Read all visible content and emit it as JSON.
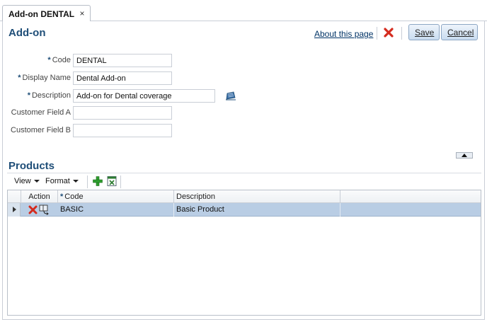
{
  "tab": {
    "label": "Add-on DENTAL",
    "close_glyph": "×"
  },
  "header": {
    "title": "Add-on",
    "about_link": "About this page",
    "delete_icon": "red-x-icon",
    "save_label": "Save",
    "cancel_label": "Cancel"
  },
  "form": {
    "required_marker": "*",
    "fields": [
      {
        "label": "Code",
        "required": true,
        "value": "DENTAL"
      },
      {
        "label": "Display Name",
        "required": true,
        "value": "Dental Add-on"
      },
      {
        "label": "Description",
        "required": true,
        "value": "Add-on for Dental coverage"
      },
      {
        "label": "Customer Field A",
        "required": false,
        "value": ""
      },
      {
        "label": "Customer Field B",
        "required": false,
        "value": ""
      }
    ]
  },
  "products": {
    "title": "Products",
    "toolbar": {
      "view_label": "View",
      "format_label": "Format"
    },
    "columns": {
      "action": "Action",
      "code": "Code",
      "description": "Description"
    },
    "rows": [
      {
        "code": "BASIC",
        "description": "Basic Product"
      }
    ]
  },
  "colors": {
    "title": "#1f4e78",
    "row_selected": "#b9cde4",
    "delete_red": "#d42b1e",
    "add_green": "#2e9e2e"
  }
}
